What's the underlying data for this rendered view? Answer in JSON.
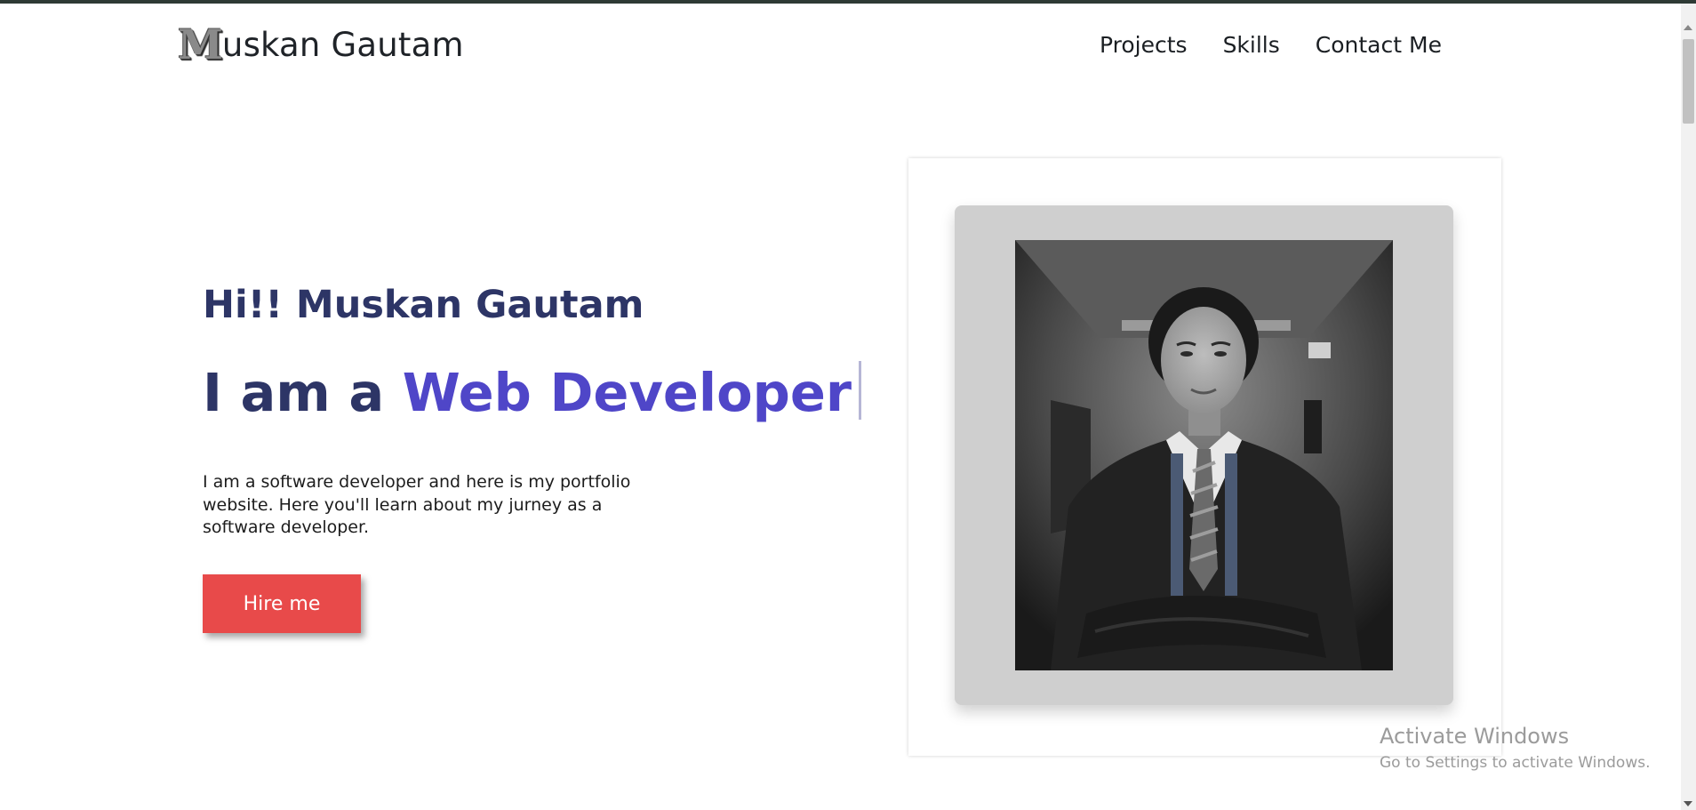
{
  "header": {
    "logo_initial": "M",
    "logo_rest": "uskan Gautam",
    "nav": [
      {
        "label": "Projects"
      },
      {
        "label": "Skills"
      },
      {
        "label": "Contact Me"
      }
    ]
  },
  "hero": {
    "greeting": "Hi!! Muskan Gautam",
    "role_prefix": "I am a ",
    "role_typed": "Web Developer",
    "description": "I am a software developer and here is my portfolio website. Here you'll learn about my jurney as a software developer.",
    "cta_label": "Hire me"
  },
  "watermark": {
    "title": "Activate Windows",
    "subtitle": "Go to Settings to activate Windows."
  },
  "colors": {
    "accent": "#4f46c8",
    "heading": "#2d3566",
    "button": "#e84a4a",
    "top_line": "#2e3a35"
  },
  "icons": {
    "photo": "profile-photo-grayscale",
    "scroll_up": "chevron-up-icon",
    "scroll_down": "chevron-down-icon"
  }
}
